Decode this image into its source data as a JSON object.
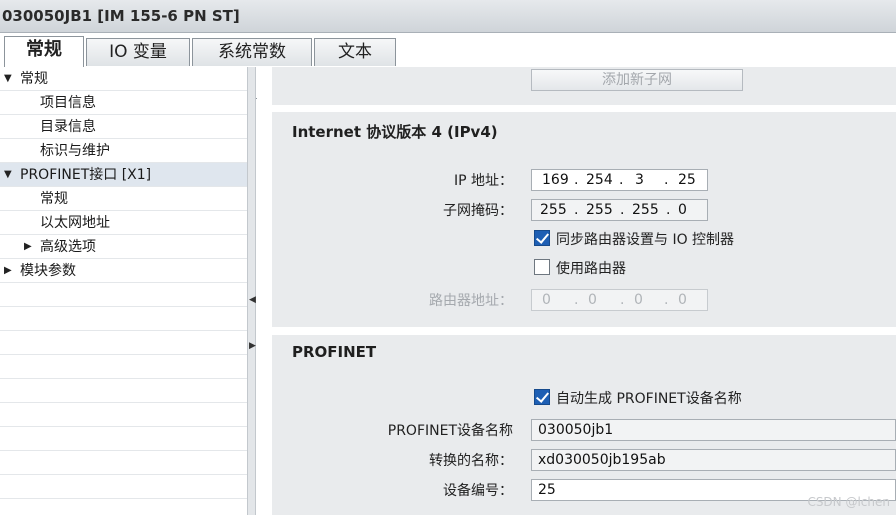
{
  "window": {
    "title": "030050JB1 [IM 155-6 PN ST]"
  },
  "tabs": [
    {
      "label": "常规",
      "active": true
    },
    {
      "label": "IO 变量",
      "active": false
    },
    {
      "label": "系统常数",
      "active": false
    },
    {
      "label": "文本",
      "active": false
    }
  ],
  "tree": [
    {
      "label": "常规",
      "arrow": "▼",
      "level": 0
    },
    {
      "label": "项目信息",
      "level": 1
    },
    {
      "label": "目录信息",
      "level": 1
    },
    {
      "label": "标识与维护",
      "level": 1
    },
    {
      "label": "PROFINET接口 [X1]",
      "arrow": "▼",
      "level": 0,
      "selected": true
    },
    {
      "label": "常规",
      "level": 1
    },
    {
      "label": "以太网地址",
      "level": 1
    },
    {
      "label": "高级选项",
      "arrow": "▶",
      "level": 1
    },
    {
      "label": "模块参数",
      "arrow": "▶",
      "level": 0
    }
  ],
  "splitter": {
    "collapse_glyph": "◀",
    "expand_glyph": "▶"
  },
  "subnet": {
    "add_button_label": "添加新子网"
  },
  "ipv4": {
    "title": "Internet 协议版本 4 (IPv4)",
    "ip_label": "IP 地址：",
    "ip": [
      "169",
      ".",
      "254",
      ".",
      "3",
      ".",
      "25"
    ],
    "mask_label": "子网掩码：",
    "mask": [
      "255",
      ".",
      "255",
      ".",
      "255",
      ".",
      "0"
    ],
    "sync_router_label": "同步路由器设置与 IO 控制器",
    "sync_router_checked": true,
    "use_router_label": "使用路由器",
    "use_router_checked": false,
    "router_label": "路由器地址：",
    "router": [
      "0",
      ".",
      "0",
      ".",
      "0",
      ".",
      "0"
    ]
  },
  "profinet": {
    "title": "PROFINET",
    "auto_name_label": "自动生成 PROFINET设备名称",
    "auto_name_checked": true,
    "device_name_label": "PROFINET设备名称",
    "device_name": "030050jb1",
    "converted_name_label": "转换的名称：",
    "converted_name": "xd030050jb195ab",
    "device_number_label": "设备编号：",
    "device_number": "25"
  },
  "watermark": "CSDN @lchen"
}
